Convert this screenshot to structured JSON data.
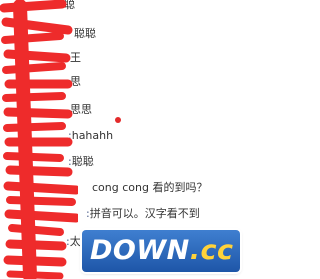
{
  "chat": {
    "messages": [
      {
        "sender_fragment": "",
        "text": "聪"
      },
      {
        "sender_fragment": "",
        "text": "聪聪"
      },
      {
        "sender_fragment": "",
        "text": "王"
      },
      {
        "sender_fragment": "",
        "text": "思"
      },
      {
        "sender_fragment": "",
        "text": "思思"
      },
      {
        "sender_fragment": ":",
        "text": "hahahh"
      },
      {
        "sender_fragment": ":",
        "text": "聪聪"
      },
      {
        "sender_fragment": "",
        "text": "cong cong 看的到吗？"
      },
      {
        "sender_fragment": ":",
        "text": "拼音可以。汉字看不到"
      },
      {
        "sender_fragment": ":",
        "text": "太"
      },
      {
        "sender_fragment": "",
        "text": ""
      }
    ]
  },
  "watermark": {
    "brand": "DOWN",
    "tld": ".cc"
  },
  "colors": {
    "redaction": "#ee2b2b",
    "dot": "#e32a2a",
    "watermark_bg": "#2a66b8",
    "watermark_tld": "#ffd23a"
  }
}
